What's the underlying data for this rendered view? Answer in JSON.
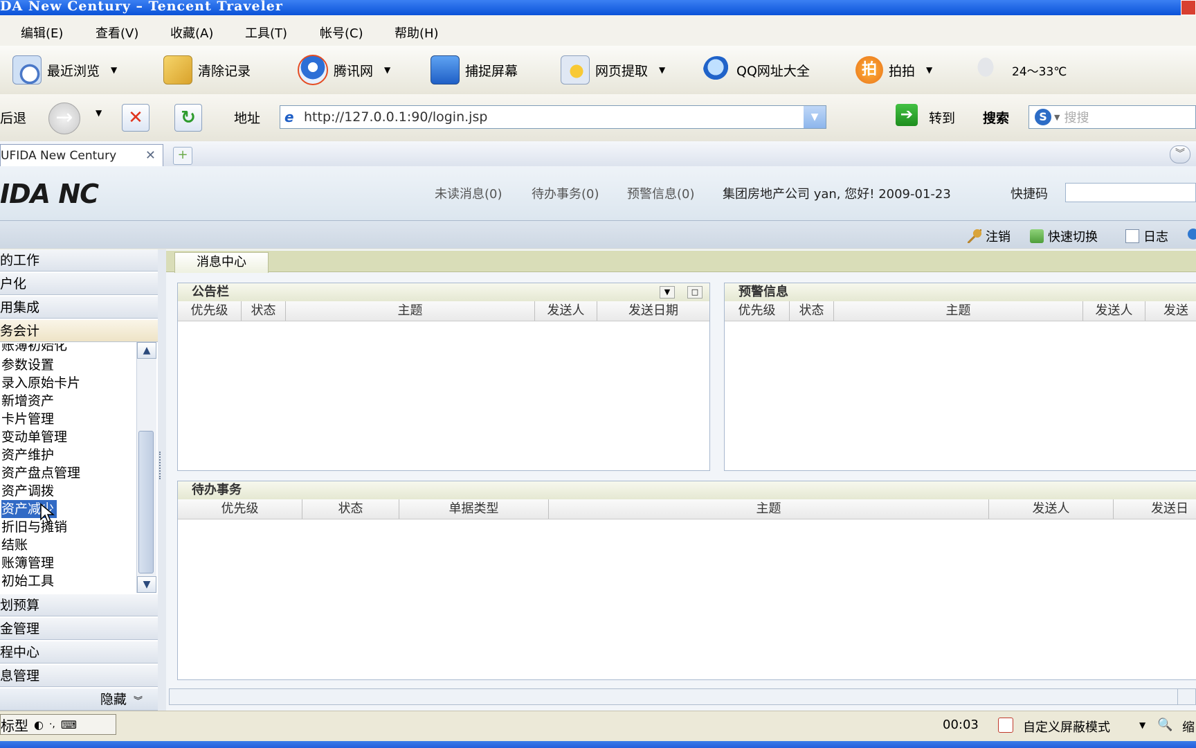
{
  "window": {
    "title": "DA New Century – Tencent Traveler"
  },
  "menu": [
    "编辑(E)",
    "查看(V)",
    "收藏(A)",
    "工具(T)",
    "帐号(C)",
    "帮助(H)"
  ],
  "toolbar": {
    "recent": "最近浏览",
    "clear": "清除记录",
    "tencent": "腾讯网",
    "capture": "捕捉屏幕",
    "extract": "网页提取",
    "qq_urls": "QQ网址大全",
    "paipai": "拍拍",
    "paipai_icon_text": "拍",
    "weather": "24～33℃"
  },
  "addressbar": {
    "back": "后退",
    "address_label": "地址",
    "url": "http://127.0.0.1:90/login.jsp",
    "go": "转到",
    "search_label": "搜索",
    "search_placeholder": "搜搜"
  },
  "tabs": {
    "active": "UFIDA New Century"
  },
  "header": {
    "logo": "IDA NC",
    "unread": "未读消息(0)",
    "todo": "待办事务(0)",
    "alerts": "预警信息(0)",
    "greeting": "集团房地产公司 yan, 您好! 2009-01-23",
    "quick_code": "快捷码"
  },
  "actions": {
    "logout": "注销",
    "switch": "快速切换",
    "log": "日志"
  },
  "sidebar": {
    "top_categories": [
      "的工作",
      "户化",
      "用集成",
      "务会计"
    ],
    "sub_items": [
      "账簿初始化",
      "参数设置",
      "录入原始卡片",
      "新增资产",
      "卡片管理",
      "变动单管理",
      "资产维护",
      "资产盘点管理",
      "资产调拨",
      "资产减少",
      "折旧与摊销",
      "结账",
      "账簿管理",
      "初始工具"
    ],
    "selected": "资产减少",
    "bottom_categories": [
      "划预算",
      "金管理",
      "程中心",
      "息管理"
    ],
    "hide": "隐藏"
  },
  "content": {
    "tab": "消息中心",
    "bulletin": {
      "title": "公告栏",
      "columns": [
        "优先级",
        "状态",
        "主题",
        "发送人",
        "发送日期"
      ]
    },
    "warning": {
      "title": "预警信息",
      "columns": [
        "优先级",
        "状态",
        "主题",
        "发送人",
        "发送"
      ]
    },
    "todo": {
      "title": "待办事务",
      "columns": [
        "优先级",
        "状态",
        "单据类型",
        "主题",
        "发送人",
        "发送日"
      ]
    }
  },
  "statusbar": {
    "ime": "标型",
    "time": "00:03",
    "mode": "自定义屏蔽模式",
    "zoom": "缩"
  }
}
